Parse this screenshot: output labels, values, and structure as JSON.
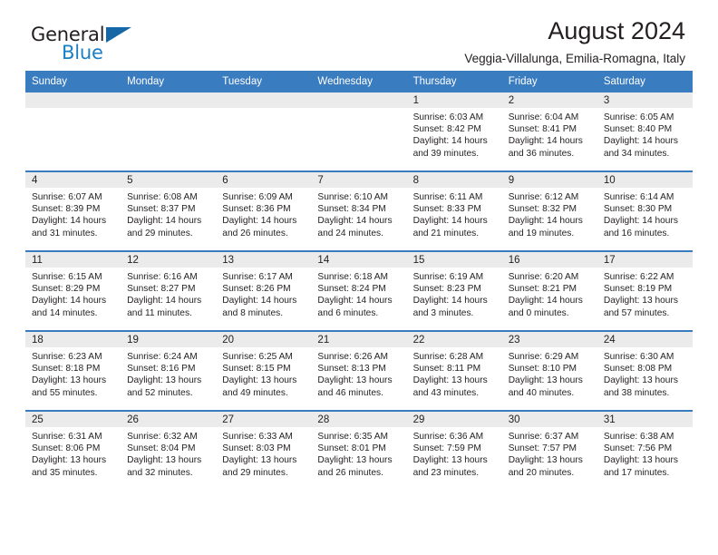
{
  "brand": {
    "word_one": "General",
    "word_two": "Blue",
    "logo_icon": "triangle-logo-icon",
    "accent_color": "#1567a8"
  },
  "header": {
    "title": "August 2024",
    "subtitle": "Veggia-Villalunga, Emilia-Romagna, Italy"
  },
  "calendar": {
    "header_bg": "#3a7cc0",
    "daynum_bg": "#ebebeb",
    "weekday_headers": [
      "Sunday",
      "Monday",
      "Tuesday",
      "Wednesday",
      "Thursday",
      "Friday",
      "Saturday"
    ],
    "weeks": [
      [
        {
          "day": "",
          "lines": []
        },
        {
          "day": "",
          "lines": []
        },
        {
          "day": "",
          "lines": []
        },
        {
          "day": "",
          "lines": []
        },
        {
          "day": "1",
          "lines": [
            "Sunrise: 6:03 AM",
            "Sunset: 8:42 PM",
            "Daylight: 14 hours",
            "and 39 minutes."
          ]
        },
        {
          "day": "2",
          "lines": [
            "Sunrise: 6:04 AM",
            "Sunset: 8:41 PM",
            "Daylight: 14 hours",
            "and 36 minutes."
          ]
        },
        {
          "day": "3",
          "lines": [
            "Sunrise: 6:05 AM",
            "Sunset: 8:40 PM",
            "Daylight: 14 hours",
            "and 34 minutes."
          ]
        }
      ],
      [
        {
          "day": "4",
          "lines": [
            "Sunrise: 6:07 AM",
            "Sunset: 8:39 PM",
            "Daylight: 14 hours",
            "and 31 minutes."
          ]
        },
        {
          "day": "5",
          "lines": [
            "Sunrise: 6:08 AM",
            "Sunset: 8:37 PM",
            "Daylight: 14 hours",
            "and 29 minutes."
          ]
        },
        {
          "day": "6",
          "lines": [
            "Sunrise: 6:09 AM",
            "Sunset: 8:36 PM",
            "Daylight: 14 hours",
            "and 26 minutes."
          ]
        },
        {
          "day": "7",
          "lines": [
            "Sunrise: 6:10 AM",
            "Sunset: 8:34 PM",
            "Daylight: 14 hours",
            "and 24 minutes."
          ]
        },
        {
          "day": "8",
          "lines": [
            "Sunrise: 6:11 AM",
            "Sunset: 8:33 PM",
            "Daylight: 14 hours",
            "and 21 minutes."
          ]
        },
        {
          "day": "9",
          "lines": [
            "Sunrise: 6:12 AM",
            "Sunset: 8:32 PM",
            "Daylight: 14 hours",
            "and 19 minutes."
          ]
        },
        {
          "day": "10",
          "lines": [
            "Sunrise: 6:14 AM",
            "Sunset: 8:30 PM",
            "Daylight: 14 hours",
            "and 16 minutes."
          ]
        }
      ],
      [
        {
          "day": "11",
          "lines": [
            "Sunrise: 6:15 AM",
            "Sunset: 8:29 PM",
            "Daylight: 14 hours",
            "and 14 minutes."
          ]
        },
        {
          "day": "12",
          "lines": [
            "Sunrise: 6:16 AM",
            "Sunset: 8:27 PM",
            "Daylight: 14 hours",
            "and 11 minutes."
          ]
        },
        {
          "day": "13",
          "lines": [
            "Sunrise: 6:17 AM",
            "Sunset: 8:26 PM",
            "Daylight: 14 hours",
            "and 8 minutes."
          ]
        },
        {
          "day": "14",
          "lines": [
            "Sunrise: 6:18 AM",
            "Sunset: 8:24 PM",
            "Daylight: 14 hours",
            "and 6 minutes."
          ]
        },
        {
          "day": "15",
          "lines": [
            "Sunrise: 6:19 AM",
            "Sunset: 8:23 PM",
            "Daylight: 14 hours",
            "and 3 minutes."
          ]
        },
        {
          "day": "16",
          "lines": [
            "Sunrise: 6:20 AM",
            "Sunset: 8:21 PM",
            "Daylight: 14 hours",
            "and 0 minutes."
          ]
        },
        {
          "day": "17",
          "lines": [
            "Sunrise: 6:22 AM",
            "Sunset: 8:19 PM",
            "Daylight: 13 hours",
            "and 57 minutes."
          ]
        }
      ],
      [
        {
          "day": "18",
          "lines": [
            "Sunrise: 6:23 AM",
            "Sunset: 8:18 PM",
            "Daylight: 13 hours",
            "and 55 minutes."
          ]
        },
        {
          "day": "19",
          "lines": [
            "Sunrise: 6:24 AM",
            "Sunset: 8:16 PM",
            "Daylight: 13 hours",
            "and 52 minutes."
          ]
        },
        {
          "day": "20",
          "lines": [
            "Sunrise: 6:25 AM",
            "Sunset: 8:15 PM",
            "Daylight: 13 hours",
            "and 49 minutes."
          ]
        },
        {
          "day": "21",
          "lines": [
            "Sunrise: 6:26 AM",
            "Sunset: 8:13 PM",
            "Daylight: 13 hours",
            "and 46 minutes."
          ]
        },
        {
          "day": "22",
          "lines": [
            "Sunrise: 6:28 AM",
            "Sunset: 8:11 PM",
            "Daylight: 13 hours",
            "and 43 minutes."
          ]
        },
        {
          "day": "23",
          "lines": [
            "Sunrise: 6:29 AM",
            "Sunset: 8:10 PM",
            "Daylight: 13 hours",
            "and 40 minutes."
          ]
        },
        {
          "day": "24",
          "lines": [
            "Sunrise: 6:30 AM",
            "Sunset: 8:08 PM",
            "Daylight: 13 hours",
            "and 38 minutes."
          ]
        }
      ],
      [
        {
          "day": "25",
          "lines": [
            "Sunrise: 6:31 AM",
            "Sunset: 8:06 PM",
            "Daylight: 13 hours",
            "and 35 minutes."
          ]
        },
        {
          "day": "26",
          "lines": [
            "Sunrise: 6:32 AM",
            "Sunset: 8:04 PM",
            "Daylight: 13 hours",
            "and 32 minutes."
          ]
        },
        {
          "day": "27",
          "lines": [
            "Sunrise: 6:33 AM",
            "Sunset: 8:03 PM",
            "Daylight: 13 hours",
            "and 29 minutes."
          ]
        },
        {
          "day": "28",
          "lines": [
            "Sunrise: 6:35 AM",
            "Sunset: 8:01 PM",
            "Daylight: 13 hours",
            "and 26 minutes."
          ]
        },
        {
          "day": "29",
          "lines": [
            "Sunrise: 6:36 AM",
            "Sunset: 7:59 PM",
            "Daylight: 13 hours",
            "and 23 minutes."
          ]
        },
        {
          "day": "30",
          "lines": [
            "Sunrise: 6:37 AM",
            "Sunset: 7:57 PM",
            "Daylight: 13 hours",
            "and 20 minutes."
          ]
        },
        {
          "day": "31",
          "lines": [
            "Sunrise: 6:38 AM",
            "Sunset: 7:56 PM",
            "Daylight: 13 hours",
            "and 17 minutes."
          ]
        }
      ]
    ]
  }
}
